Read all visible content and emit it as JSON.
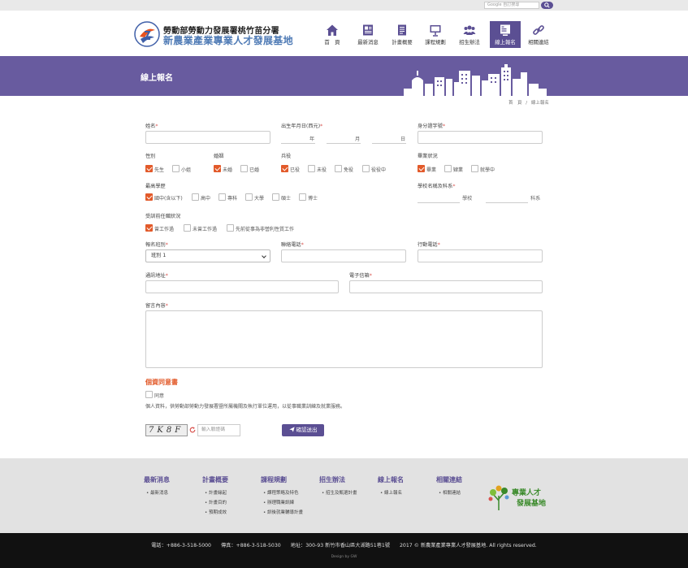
{
  "search": {
    "placeholder": "Google 自訂搜尋"
  },
  "header": {
    "org_line1": "勞動部勞動力發展署桃竹苗分署",
    "org_line2": "新農業產業專業人才發展基地"
  },
  "nav": [
    {
      "label": "首　頁",
      "icon": "home-icon"
    },
    {
      "label": "最新消息",
      "icon": "news-icon"
    },
    {
      "label": "計畫概要",
      "icon": "document-icon"
    },
    {
      "label": "課程規劃",
      "icon": "presentation-icon"
    },
    {
      "label": "招生辦法",
      "icon": "users-icon"
    },
    {
      "label": "線上報名",
      "icon": "register-icon",
      "active": true
    },
    {
      "label": "相關連結",
      "icon": "link-icon"
    }
  ],
  "banner": {
    "title": "線上報名"
  },
  "breadcrumb": {
    "home": "首　頁",
    "sep": "/",
    "current": "線上報名"
  },
  "form": {
    "name_label": "姓名",
    "birth_label": "出生年月日(西元)",
    "birth_units": [
      "年",
      "月",
      "日"
    ],
    "id_label": "身分證字號",
    "gender_label": "性別",
    "gender_options": [
      {
        "label": "先生",
        "checked": true
      },
      {
        "label": "小姐",
        "checked": false
      }
    ],
    "marriage_label": "婚姻",
    "marriage_options": [
      {
        "label": "未婚",
        "checked": true
      },
      {
        "label": "已婚",
        "checked": false
      }
    ],
    "military_label": "兵役",
    "military_options": [
      {
        "label": "已役",
        "checked": true
      },
      {
        "label": "未役",
        "checked": false
      },
      {
        "label": "免役",
        "checked": false
      },
      {
        "label": "役役中",
        "checked": false
      }
    ],
    "grad_label": "畢業狀況",
    "grad_options": [
      {
        "label": "畢業",
        "checked": true
      },
      {
        "label": "肄業",
        "checked": false
      },
      {
        "label": "就學中",
        "checked": false
      }
    ],
    "edu_label": "最高學歷",
    "edu_options": [
      {
        "label": "國中(含以下)",
        "checked": true
      },
      {
        "label": "高中",
        "checked": false
      },
      {
        "label": "專科",
        "checked": false
      },
      {
        "label": "大學",
        "checked": false
      },
      {
        "label": "碩士",
        "checked": false
      },
      {
        "label": "博士",
        "checked": false
      }
    ],
    "school_label": "學校名稱及科系",
    "school_units": [
      "學校",
      "科系"
    ],
    "work_label": "受訓前任職狀況",
    "work_options": [
      {
        "label": "曾工作過",
        "checked": true
      },
      {
        "label": "未曾工作過",
        "checked": false
      },
      {
        "label": "先前從事為非營利性質工作",
        "checked": false
      }
    ],
    "class_label": "報名班別",
    "class_value": "班別 1",
    "phone_label": "聯絡電話",
    "mobile_label": "行動電話",
    "address_label": "通訊地址",
    "email_label": "電子信箱",
    "message_label": "留言內容",
    "required_mark": "*"
  },
  "privacy": {
    "title": "個資同意書",
    "agree_label": "同意",
    "text": "個人資料，供勞動部勞動力發展署暨所屬機關及執行單位運用，以從事職業訓練及就業服務。"
  },
  "captcha": {
    "code": "7K8F",
    "placeholder": "輸入驗證碼",
    "submit_label": "確認送出"
  },
  "footer": {
    "columns": [
      {
        "title": "最新消息",
        "links": [
          "最新消息"
        ]
      },
      {
        "title": "計畫概要",
        "links": [
          "計畫緣起",
          "計畫目的",
          "預期成效"
        ]
      },
      {
        "title": "課程規劃",
        "links": [
          "課程策略及特色",
          "辦理職業訓練",
          "訓後就業輔導計畫"
        ]
      },
      {
        "title": "招生辦法",
        "links": [
          "招生及甄選計畫"
        ]
      },
      {
        "title": "線上報名",
        "links": [
          "線上報名"
        ]
      },
      {
        "title": "相關連結",
        "links": [
          "相關連結"
        ]
      }
    ],
    "logo_text_1": "專業人才",
    "logo_text_2": "發展基地"
  },
  "bottom": {
    "phone": "電話：+886-3-518-5000",
    "fax": "傳真：+886-3-518-5030",
    "address": "地址：300-93 新竹市香山區大湖路51巷1號",
    "copyright": "2017 © 新農業產業專業人才發展基地. All rights reserved.",
    "design": "Design by GW"
  },
  "colors": {
    "brand": "#5b4f93",
    "banner": "#685b9f",
    "accent": "#e25a2a"
  }
}
